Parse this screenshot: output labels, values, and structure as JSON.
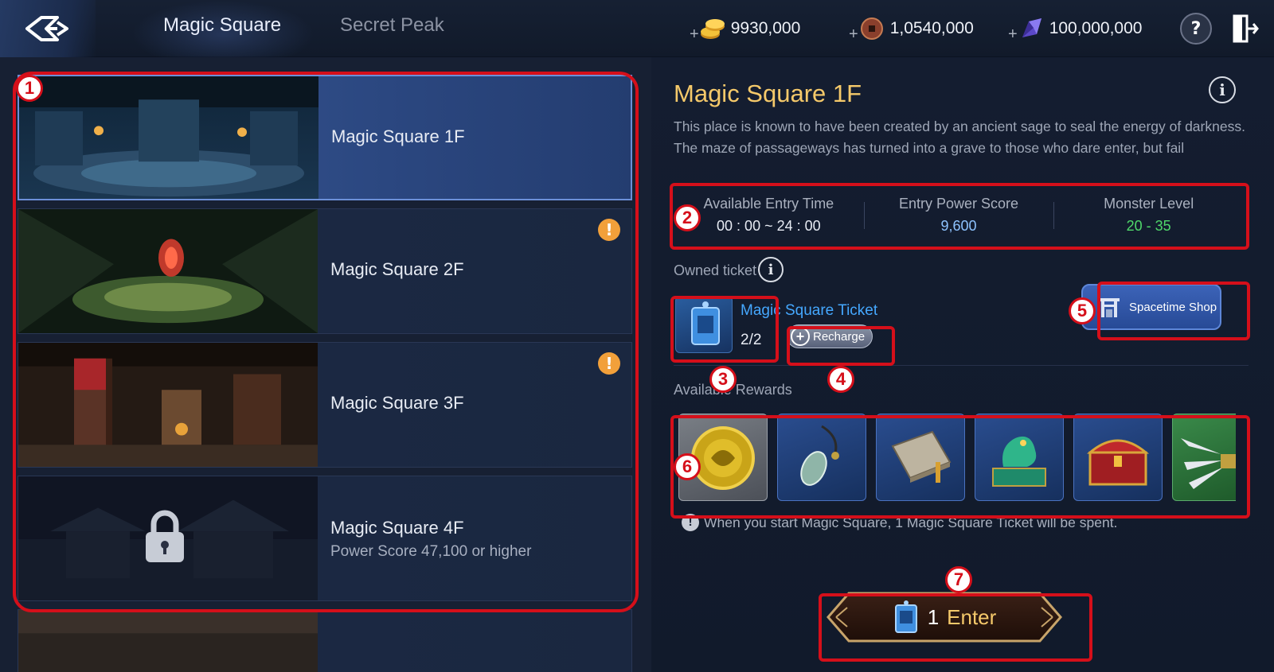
{
  "header": {
    "tabs": [
      {
        "label": "Magic Square",
        "active": true
      },
      {
        "label": "Secret Peak",
        "active": false
      }
    ],
    "currencies": [
      {
        "icon": "gold-coins-icon",
        "plus": "+",
        "amount": "9930,000"
      },
      {
        "icon": "bronze-coin-icon",
        "plus": "+",
        "amount": "1,0540,000"
      },
      {
        "icon": "purple-crystal-icon",
        "plus": "+",
        "amount": "100,000,000"
      }
    ],
    "help_symbol": "?"
  },
  "floors": [
    {
      "title": "Magic Square 1F",
      "subtitle": "",
      "selected": true,
      "alert": false,
      "locked": false
    },
    {
      "title": "Magic Square 2F",
      "subtitle": "",
      "selected": false,
      "alert": true,
      "locked": false
    },
    {
      "title": "Magic Square 3F",
      "subtitle": "",
      "selected": false,
      "alert": true,
      "locked": false
    },
    {
      "title": "Magic Square 4F",
      "subtitle": "Power Score 47,100 or higher",
      "selected": false,
      "alert": false,
      "locked": true
    }
  ],
  "alert_symbol": "!",
  "detail": {
    "title": "Magic Square 1F",
    "description_line1": "This place is known to have been created by an ancient sage to seal the energy of darkness.",
    "description_line2": "The maze of passageways has turned into a grave to those who dare enter, but fail",
    "info_symbol": "i",
    "stats": [
      {
        "label": "Available Entry Time",
        "value": "00 : 00 ~ 24 : 00",
        "color": "#e8ecf4"
      },
      {
        "label": "Entry Power Score",
        "value": "9,600",
        "color": "#8ec3ff"
      },
      {
        "label": "Monster Level",
        "value": "20 - 35",
        "color": "#4fd86a"
      }
    ],
    "owned_ticket_label": "Owned ticket",
    "ticket_name": "Magic Square Ticket",
    "ticket_count": "2/2",
    "recharge_label": "Recharge",
    "shop_label": "Spacetime Shop",
    "rewards_label": "Available Rewards",
    "rewards": [
      {
        "icon": "gold-medallion-icon"
      },
      {
        "icon": "jade-pendant-icon"
      },
      {
        "icon": "book-icon"
      },
      {
        "icon": "jade-dragon-seal-icon"
      },
      {
        "icon": "treasure-chest-icon"
      },
      {
        "icon": "silver-claw-weapon-icon"
      }
    ],
    "note": "When you start Magic Square, 1 Magic Square Ticket will be spent.",
    "enter_count": "1",
    "enter_label": "Enter"
  },
  "annotations": [
    "1",
    "2",
    "3",
    "4",
    "5",
    "6",
    "7"
  ],
  "colors": {
    "accent_gold": "#f5c96a",
    "annotation_red": "#d50f1a",
    "link_blue": "#45a8ff"
  }
}
